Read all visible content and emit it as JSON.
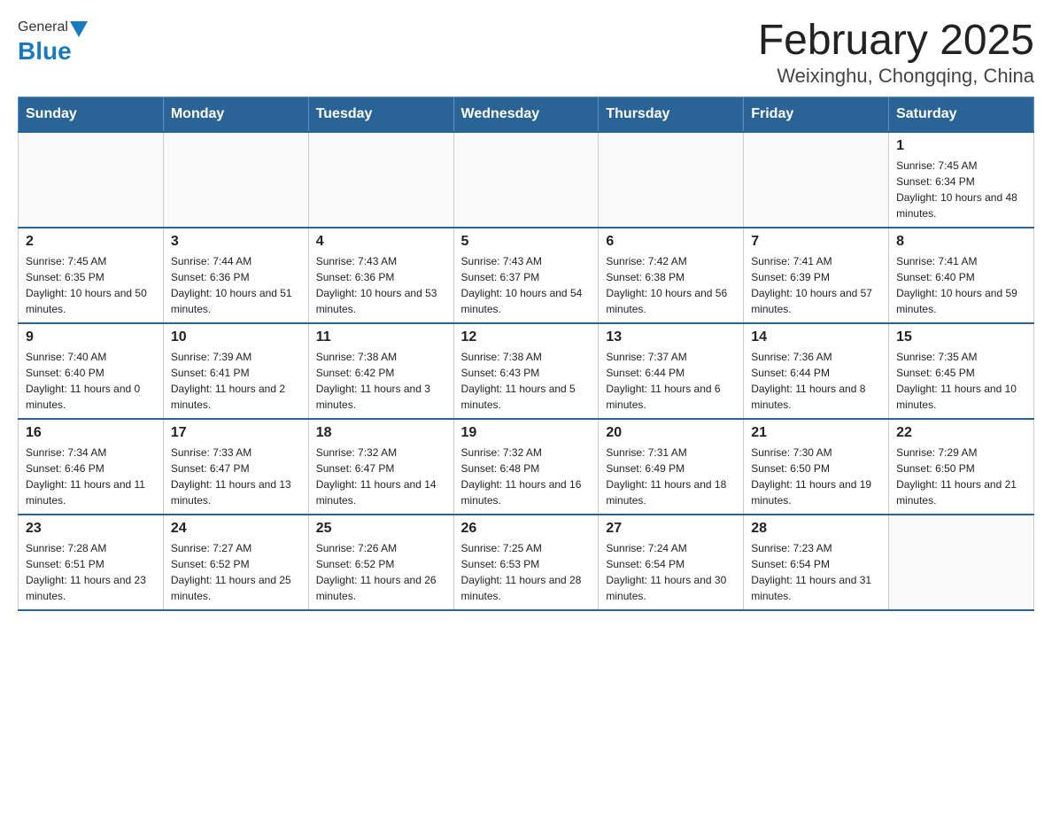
{
  "header": {
    "logo": {
      "general": "General",
      "blue": "Blue"
    },
    "title": "February 2025",
    "subtitle": "Weixinghu, Chongqing, China"
  },
  "days_of_week": [
    "Sunday",
    "Monday",
    "Tuesday",
    "Wednesday",
    "Thursday",
    "Friday",
    "Saturday"
  ],
  "weeks": [
    {
      "days": [
        {
          "date": "",
          "info": ""
        },
        {
          "date": "",
          "info": ""
        },
        {
          "date": "",
          "info": ""
        },
        {
          "date": "",
          "info": ""
        },
        {
          "date": "",
          "info": ""
        },
        {
          "date": "",
          "info": ""
        },
        {
          "date": "1",
          "info": "Sunrise: 7:45 AM\nSunset: 6:34 PM\nDaylight: 10 hours and 48 minutes."
        }
      ]
    },
    {
      "days": [
        {
          "date": "2",
          "info": "Sunrise: 7:45 AM\nSunset: 6:35 PM\nDaylight: 10 hours and 50 minutes."
        },
        {
          "date": "3",
          "info": "Sunrise: 7:44 AM\nSunset: 6:36 PM\nDaylight: 10 hours and 51 minutes."
        },
        {
          "date": "4",
          "info": "Sunrise: 7:43 AM\nSunset: 6:36 PM\nDaylight: 10 hours and 53 minutes."
        },
        {
          "date": "5",
          "info": "Sunrise: 7:43 AM\nSunset: 6:37 PM\nDaylight: 10 hours and 54 minutes."
        },
        {
          "date": "6",
          "info": "Sunrise: 7:42 AM\nSunset: 6:38 PM\nDaylight: 10 hours and 56 minutes."
        },
        {
          "date": "7",
          "info": "Sunrise: 7:41 AM\nSunset: 6:39 PM\nDaylight: 10 hours and 57 minutes."
        },
        {
          "date": "8",
          "info": "Sunrise: 7:41 AM\nSunset: 6:40 PM\nDaylight: 10 hours and 59 minutes."
        }
      ]
    },
    {
      "days": [
        {
          "date": "9",
          "info": "Sunrise: 7:40 AM\nSunset: 6:40 PM\nDaylight: 11 hours and 0 minutes."
        },
        {
          "date": "10",
          "info": "Sunrise: 7:39 AM\nSunset: 6:41 PM\nDaylight: 11 hours and 2 minutes."
        },
        {
          "date": "11",
          "info": "Sunrise: 7:38 AM\nSunset: 6:42 PM\nDaylight: 11 hours and 3 minutes."
        },
        {
          "date": "12",
          "info": "Sunrise: 7:38 AM\nSunset: 6:43 PM\nDaylight: 11 hours and 5 minutes."
        },
        {
          "date": "13",
          "info": "Sunrise: 7:37 AM\nSunset: 6:44 PM\nDaylight: 11 hours and 6 minutes."
        },
        {
          "date": "14",
          "info": "Sunrise: 7:36 AM\nSunset: 6:44 PM\nDaylight: 11 hours and 8 minutes."
        },
        {
          "date": "15",
          "info": "Sunrise: 7:35 AM\nSunset: 6:45 PM\nDaylight: 11 hours and 10 minutes."
        }
      ]
    },
    {
      "days": [
        {
          "date": "16",
          "info": "Sunrise: 7:34 AM\nSunset: 6:46 PM\nDaylight: 11 hours and 11 minutes."
        },
        {
          "date": "17",
          "info": "Sunrise: 7:33 AM\nSunset: 6:47 PM\nDaylight: 11 hours and 13 minutes."
        },
        {
          "date": "18",
          "info": "Sunrise: 7:32 AM\nSunset: 6:47 PM\nDaylight: 11 hours and 14 minutes."
        },
        {
          "date": "19",
          "info": "Sunrise: 7:32 AM\nSunset: 6:48 PM\nDaylight: 11 hours and 16 minutes."
        },
        {
          "date": "20",
          "info": "Sunrise: 7:31 AM\nSunset: 6:49 PM\nDaylight: 11 hours and 18 minutes."
        },
        {
          "date": "21",
          "info": "Sunrise: 7:30 AM\nSunset: 6:50 PM\nDaylight: 11 hours and 19 minutes."
        },
        {
          "date": "22",
          "info": "Sunrise: 7:29 AM\nSunset: 6:50 PM\nDaylight: 11 hours and 21 minutes."
        }
      ]
    },
    {
      "days": [
        {
          "date": "23",
          "info": "Sunrise: 7:28 AM\nSunset: 6:51 PM\nDaylight: 11 hours and 23 minutes."
        },
        {
          "date": "24",
          "info": "Sunrise: 7:27 AM\nSunset: 6:52 PM\nDaylight: 11 hours and 25 minutes."
        },
        {
          "date": "25",
          "info": "Sunrise: 7:26 AM\nSunset: 6:52 PM\nDaylight: 11 hours and 26 minutes."
        },
        {
          "date": "26",
          "info": "Sunrise: 7:25 AM\nSunset: 6:53 PM\nDaylight: 11 hours and 28 minutes."
        },
        {
          "date": "27",
          "info": "Sunrise: 7:24 AM\nSunset: 6:54 PM\nDaylight: 11 hours and 30 minutes."
        },
        {
          "date": "28",
          "info": "Sunrise: 7:23 AM\nSunset: 6:54 PM\nDaylight: 11 hours and 31 minutes."
        },
        {
          "date": "",
          "info": ""
        }
      ]
    }
  ]
}
